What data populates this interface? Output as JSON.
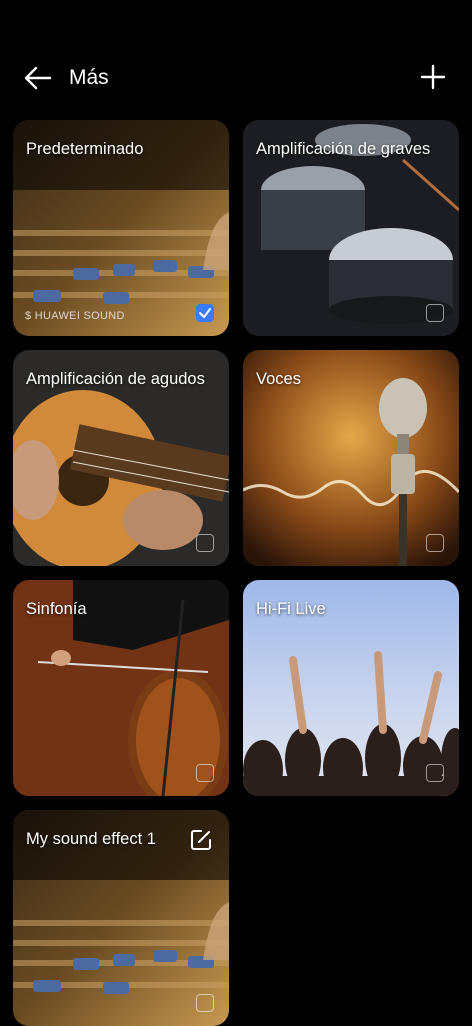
{
  "header": {
    "title": "Más"
  },
  "cards": [
    {
      "label": "Predeterminado",
      "brand": "HUAWEI SOUND",
      "selected": true
    },
    {
      "label": "Amplificación de graves",
      "selected": false
    },
    {
      "label": "Amplificación de agudos",
      "selected": false
    },
    {
      "label": "Voces",
      "selected": false
    },
    {
      "label": "Sinfonía",
      "selected": false
    },
    {
      "label": "Hi-Fi Live",
      "selected": false
    },
    {
      "label": "My sound effect 1",
      "selected": false,
      "editable": true
    }
  ],
  "icons": {
    "back": "arrow-left-icon",
    "add": "plus-icon",
    "check": "checkmark-icon",
    "edit": "edit-icon",
    "brand": "huawei-sound-logo"
  },
  "colors": {
    "background": "#000000",
    "accent": "#3a7bfd"
  }
}
